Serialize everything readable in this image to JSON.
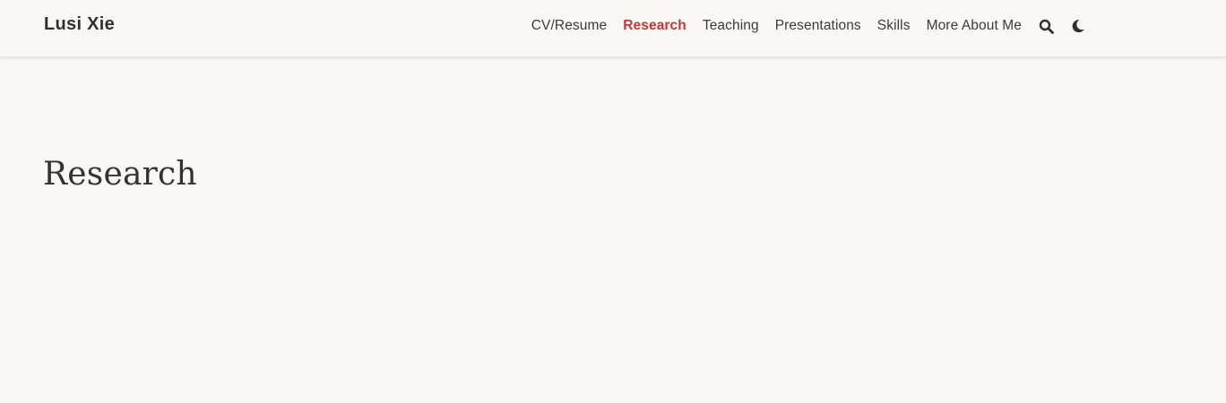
{
  "site": {
    "brand": "Lusi Xie"
  },
  "nav": {
    "items": [
      {
        "label": "CV/Resume",
        "active": false
      },
      {
        "label": "Research",
        "active": true
      },
      {
        "label": "Teaching",
        "active": false
      },
      {
        "label": "Presentations",
        "active": false
      },
      {
        "label": "Skills",
        "active": false
      },
      {
        "label": "More About Me",
        "active": false
      }
    ],
    "icons": {
      "search": "search-icon",
      "theme": "moon-icon"
    }
  },
  "main": {
    "title": "Research"
  },
  "colors": {
    "background": "#f9f8f4",
    "accent": "#c8363a",
    "text": "#333333"
  }
}
